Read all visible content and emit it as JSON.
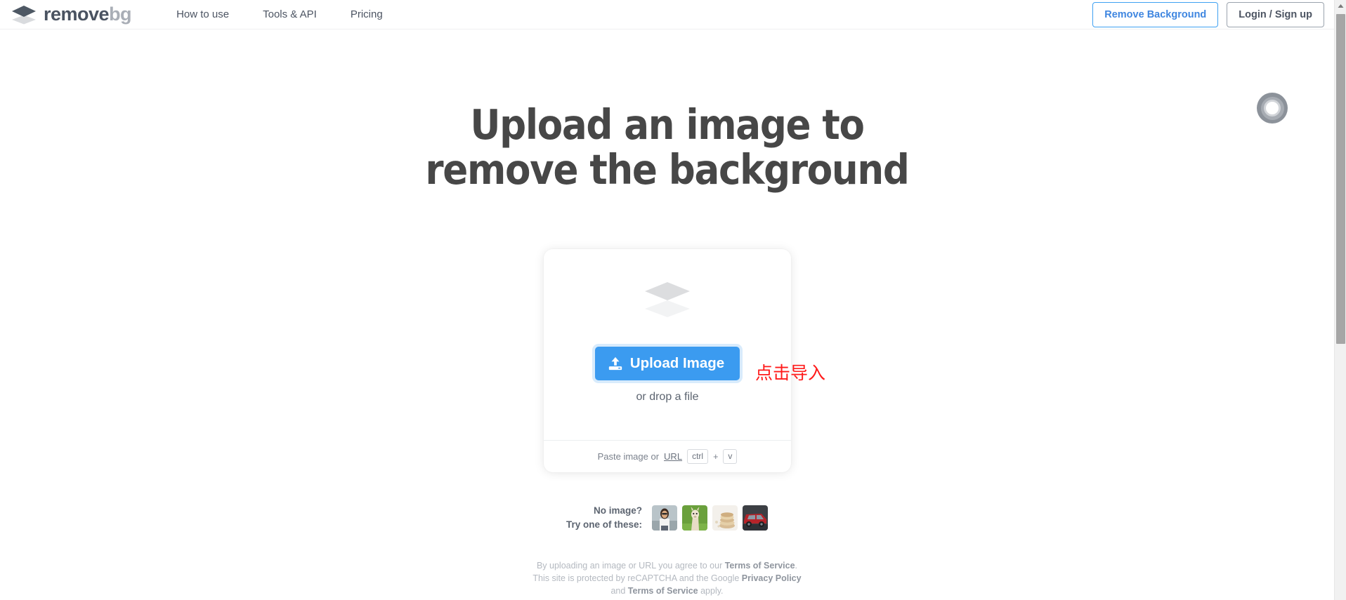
{
  "header": {
    "logo": {
      "icon": "stacked-layers-logo-icon",
      "name_dark": "remove",
      "name_gray": "bg"
    },
    "nav": [
      {
        "label": "How to use"
      },
      {
        "label": "Tools & API"
      },
      {
        "label": "Pricing"
      }
    ],
    "actions": {
      "remove_background": "Remove Background",
      "login_signup": "Login / Sign up"
    },
    "colors": {
      "accent_blue": "#3f86e0",
      "border_blue": "#3fa1f2",
      "text_dark": "#4c5462"
    }
  },
  "hero": {
    "line1": "Upload an image to",
    "line2": "remove the background"
  },
  "upload_card": {
    "placeholder_icon": "stacked-layers-icon",
    "button_label": "Upload Image",
    "button_icon": "upload-icon",
    "drop_text": "or drop a file",
    "paste_prefix": "Paste image or",
    "paste_link": "URL",
    "key_ctrl": "ctrl",
    "key_plus": "+",
    "key_v": "v",
    "button_color": "#3b9bf0"
  },
  "annotation": {
    "text": "点击导入",
    "color": "#ff1a1a"
  },
  "samples": {
    "label_line1": "No image?",
    "label_line2": "Try one of these:",
    "thumbnails": [
      {
        "name": "sample-woman-sunglasses"
      },
      {
        "name": "sample-llama"
      },
      {
        "name": "sample-pancakes"
      },
      {
        "name": "sample-red-suv"
      }
    ]
  },
  "legal": {
    "l1_a": "By uploading an image or URL you agree to our ",
    "l1_b": "Terms of Service",
    "l1_c": ".",
    "l2_a": "This site is protected by reCAPTCHA and the Google ",
    "l2_b": "Privacy Policy",
    "l3_a": "and ",
    "l3_b": "Terms of Service",
    "l3_c": " apply."
  },
  "indicator": {
    "name": "click-ring-indicator"
  },
  "scrollbar": {
    "name": "vertical-scrollbar"
  }
}
